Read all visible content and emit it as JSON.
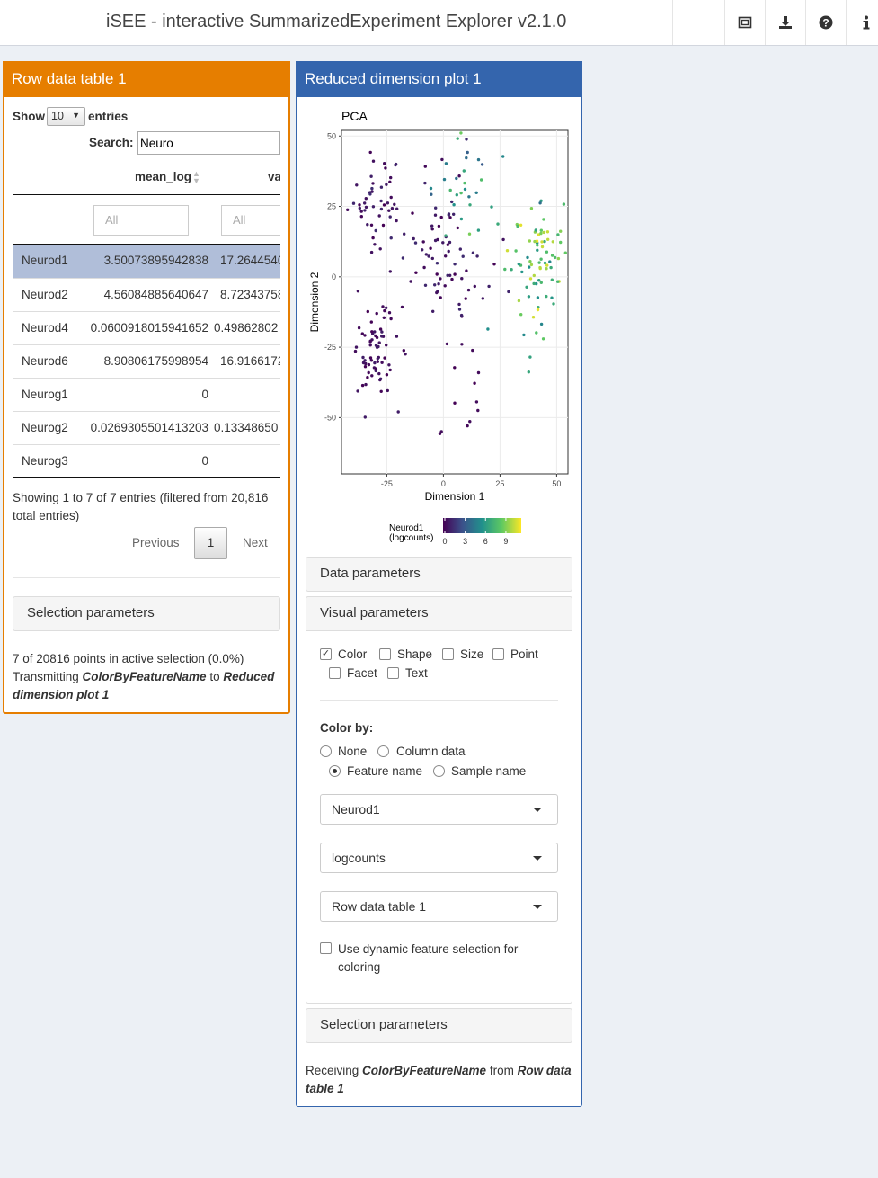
{
  "header": {
    "title": "iSEE - interactive SummarizedExperiment Explorer v2.1.0",
    "icons": [
      "screenshot-icon",
      "download-icon",
      "question-circle-icon",
      "info-icon"
    ]
  },
  "row_table": {
    "title": "Row data table 1",
    "show_label": "Show",
    "page_length": "10",
    "entries_label": "entries",
    "search_label": "Search:",
    "search_value": "Neuro",
    "columns": [
      "mean_log",
      "va"
    ],
    "filter_placeholder": "All",
    "rows": [
      {
        "name": "Neurod1",
        "mean_log": "3.50073895942838",
        "var": "17.2644540"
      },
      {
        "name": "Neurod2",
        "mean_log": "4.56084885640647",
        "var": "8.72343758"
      },
      {
        "name": "Neurod4",
        "mean_log": "0.0600918015941652",
        "var": "0.49862802"
      },
      {
        "name": "Neurod6",
        "mean_log": "8.90806175998954",
        "var": "16.9166172"
      },
      {
        "name": "Neurog1",
        "mean_log": "0",
        "var": ""
      },
      {
        "name": "Neurog2",
        "mean_log": "0.0269305501413203",
        "var": "0.13348650"
      },
      {
        "name": "Neurog3",
        "mean_log": "0",
        "var": ""
      }
    ],
    "info": "Showing 1 to 7 of 7 entries (filtered from 20,816 total entries)",
    "pagination": {
      "previous": "Previous",
      "page": "1",
      "next": "Next"
    },
    "selection_panel": "Selection parameters",
    "status_line1": "7 of 20816 points in active selection (0.0%)",
    "status_prefix": "Transmitting ",
    "status_var": "ColorByFeatureName",
    "status_to": " to ",
    "status_target": "Reduced dimension plot 1"
  },
  "redim_plot": {
    "title": "Reduced dimension plot 1",
    "data_panel": "Data parameters",
    "visual_panel": "Visual parameters",
    "checkboxes": [
      {
        "label": "Color",
        "checked": true
      },
      {
        "label": "Shape",
        "checked": false
      },
      {
        "label": "Size",
        "checked": false
      },
      {
        "label": "Point",
        "checked": false
      },
      {
        "label": "Facet",
        "checked": false
      },
      {
        "label": "Text",
        "checked": false
      }
    ],
    "color_by_label": "Color by:",
    "radios": [
      {
        "label": "None",
        "selected": false
      },
      {
        "label": "Column data",
        "selected": false
      },
      {
        "label": "Feature name",
        "selected": true
      },
      {
        "label": "Sample name",
        "selected": false
      }
    ],
    "select_feature": "Neurod1",
    "select_assay": "logcounts",
    "select_source": "Row data table 1",
    "dynamic_label": "Use dynamic feature selection for coloring",
    "selection_panel": "Selection parameters",
    "receiving_prefix": "Receiving ",
    "receiving_var": "ColorByFeatureName",
    "receiving_from": " from ",
    "receiving_source": "Row data table 1"
  },
  "chart_data": {
    "type": "scatter",
    "title": "PCA",
    "xlabel": "Dimension 1",
    "ylabel": "Dimension 2",
    "xlim": [
      -45,
      55
    ],
    "ylim": [
      -70,
      52
    ],
    "xticks": [
      -25,
      0,
      25,
      50
    ],
    "yticks": [
      50,
      25,
      0,
      -25,
      -50
    ],
    "grid": true,
    "legend": {
      "title_line1": "Neurod1",
      "title_line2": "(logcounts)",
      "ticks": [
        0,
        3,
        6,
        9
      ],
      "colormap": "viridis",
      "range": [
        0,
        11
      ]
    },
    "clusters": [
      {
        "cx": -30,
        "cy": 28,
        "sx": 6,
        "sy": 8,
        "n": 45,
        "vmin": 0,
        "vmax": 1.5
      },
      {
        "cx": -30,
        "cy": -28,
        "sx": 5,
        "sy": 9,
        "n": 70,
        "vmin": 0,
        "vmax": 1
      },
      {
        "cx": 0,
        "cy": 10,
        "sx": 10,
        "sy": 14,
        "n": 80,
        "vmin": 0,
        "vmax": 1.5
      },
      {
        "cx": 40,
        "cy": 3,
        "sx": 6,
        "sy": 14,
        "n": 80,
        "vmin": 5,
        "vmax": 11
      },
      {
        "cx": 10,
        "cy": 30,
        "sx": 10,
        "sy": 10,
        "n": 30,
        "vmin": 2,
        "vmax": 9
      },
      {
        "cx": 0,
        "cy": -45,
        "sx": 10,
        "sy": 12,
        "n": 12,
        "vmin": 0,
        "vmax": 0.5
      }
    ]
  }
}
